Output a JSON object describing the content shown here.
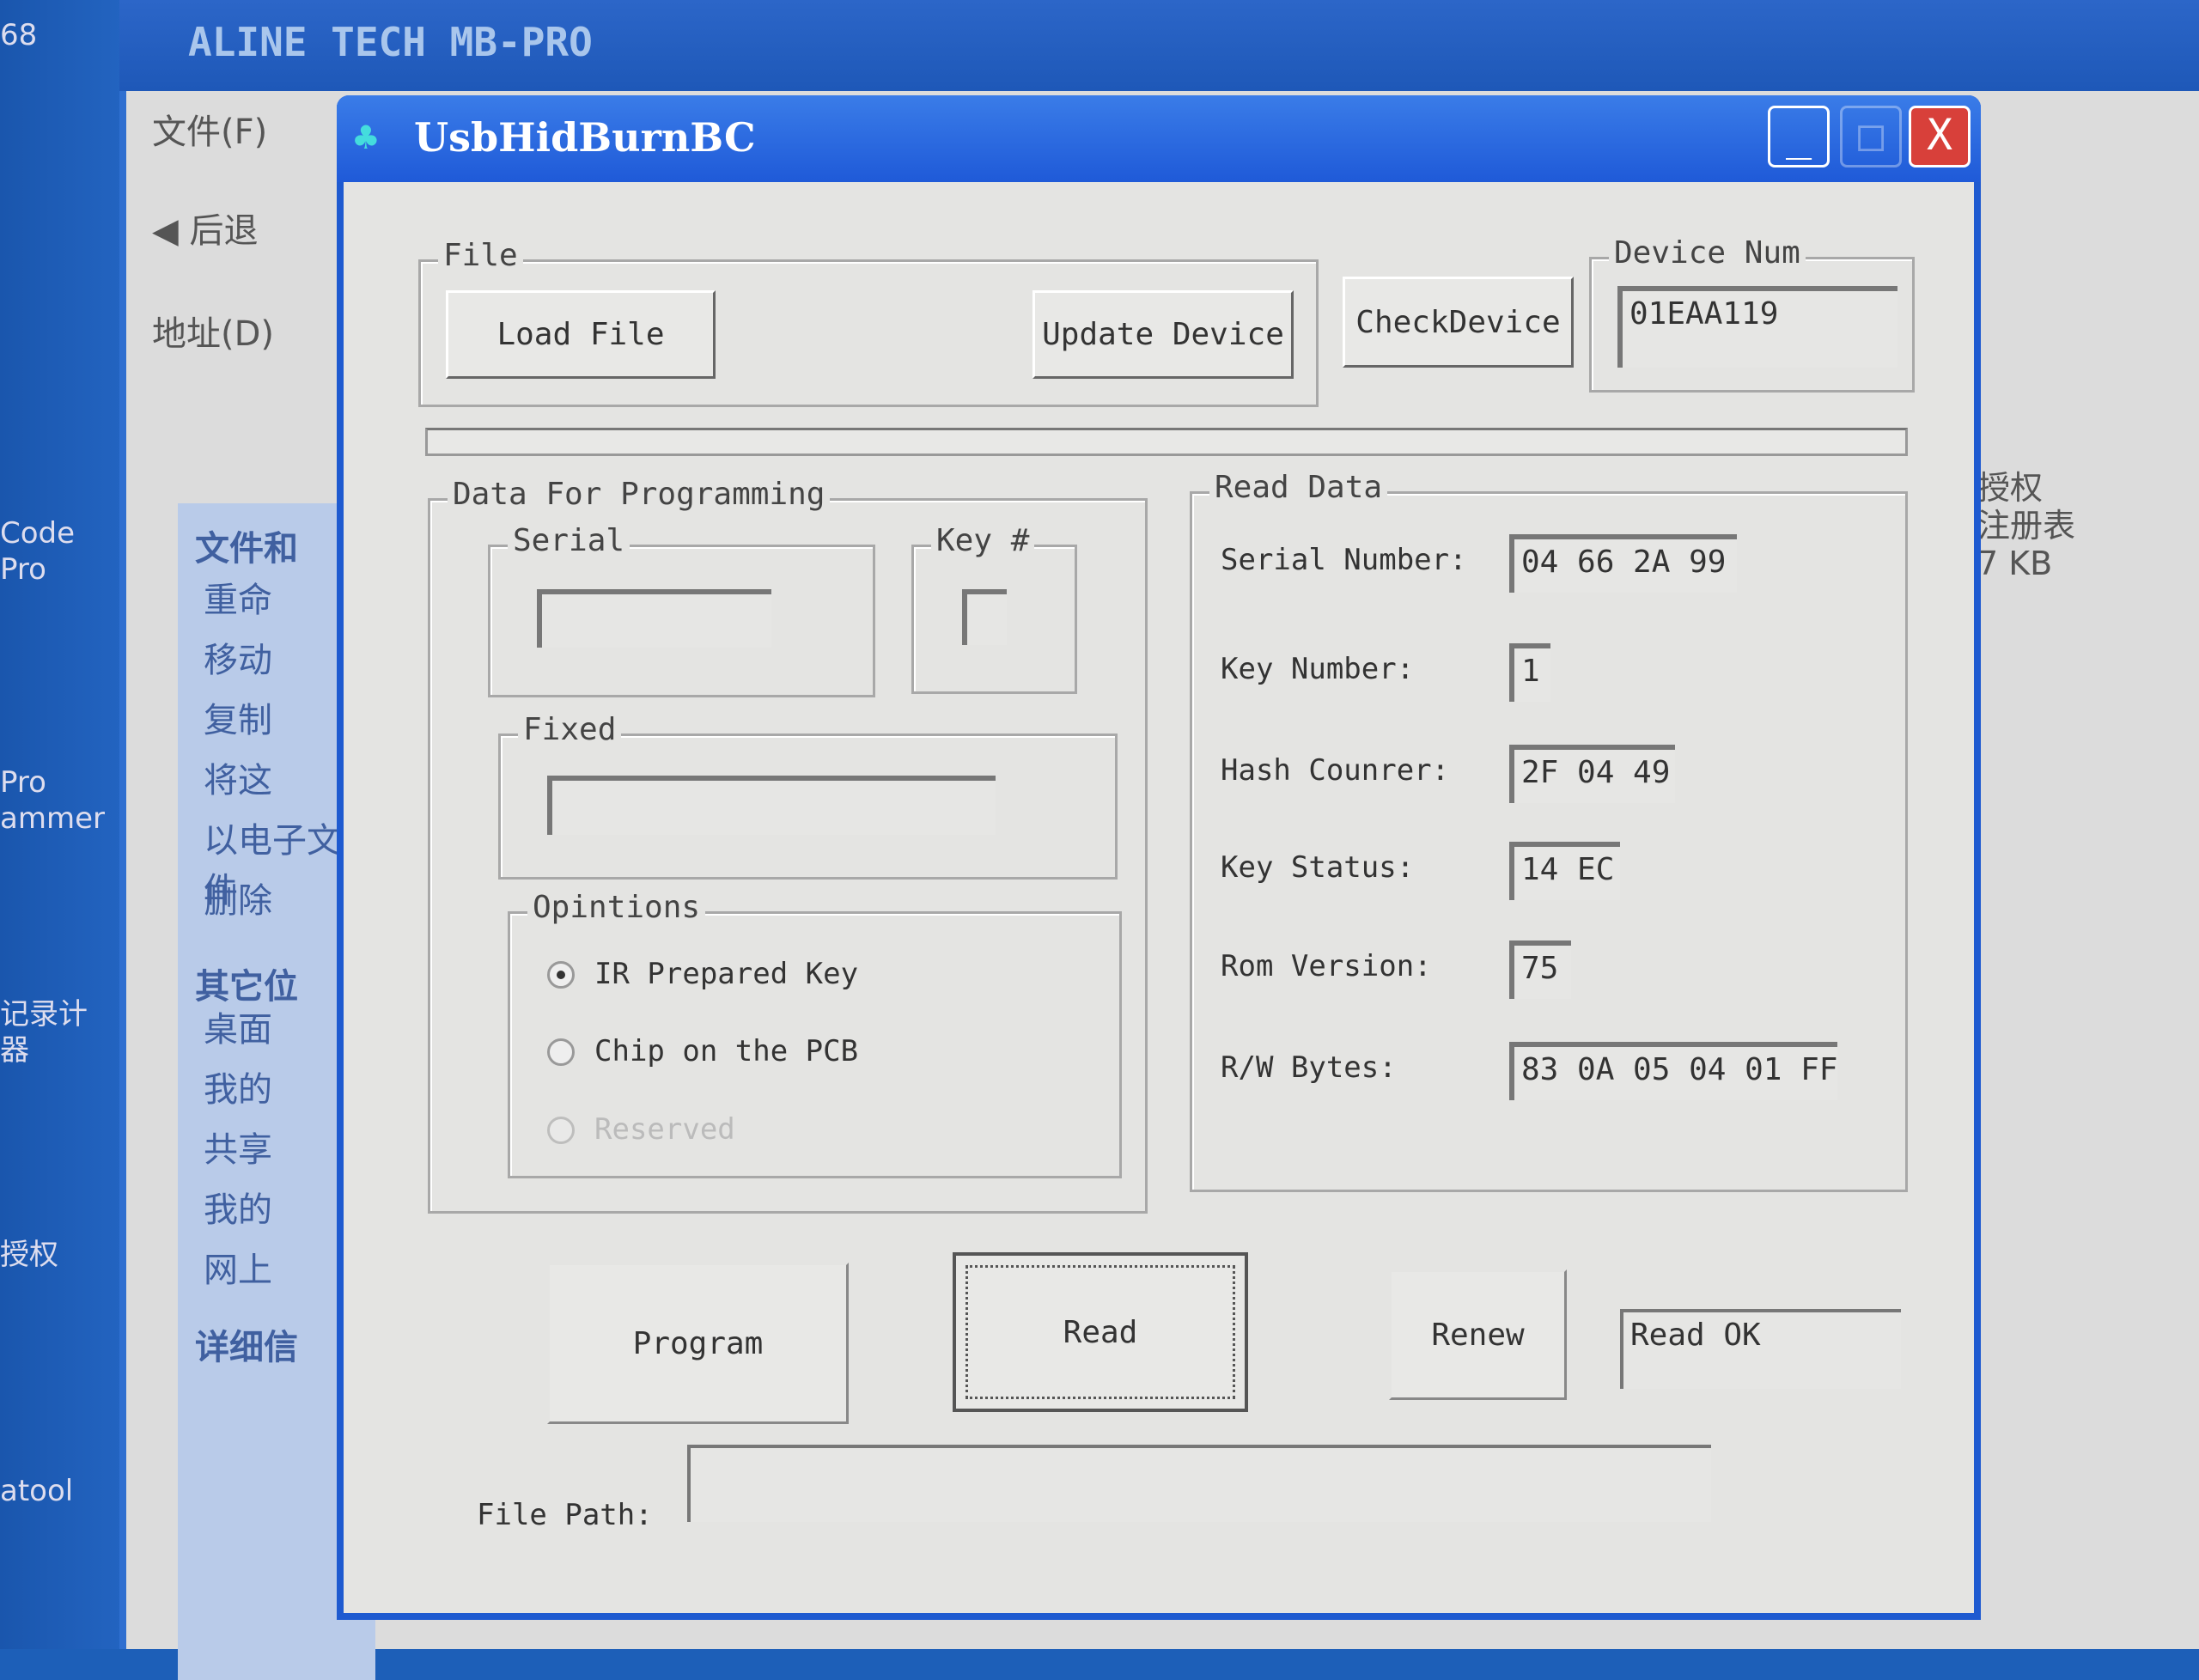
{
  "desktop": {
    "icons": [
      "68",
      "Code\nPro",
      "Pro\nammer",
      "记录计\n器",
      "授权",
      "atool"
    ]
  },
  "explorer": {
    "title": "ALINE TECH MB-PRO",
    "menu_file": "文件(F)",
    "back": "后退",
    "address": "地址(D)",
    "side_header1": "文件和",
    "side_items": [
      "重命",
      "移动",
      "复制",
      "将这",
      "以电子文件",
      "删除"
    ],
    "side_header2": "其它位",
    "other_items": [
      "桌面",
      "我的",
      "共享",
      "我的",
      "网上"
    ],
    "side_header3": "详细信",
    "file_name": "授权",
    "file_type": "注册表",
    "file_size": "7 KB"
  },
  "dialog": {
    "title": "UsbHidBurnBC",
    "minimize": "_",
    "maximize": "□",
    "close": "X",
    "file_group": "File",
    "load_file": "Load File",
    "update_device": "Update Device",
    "check_device": "CheckDevice",
    "device_num_group": "Device Num",
    "device_num": "01EAA119",
    "progress": 0,
    "data_group": "Data For Programming",
    "serial_group": "Serial",
    "serial_value": "",
    "key_group": "Key #",
    "key_value": "",
    "fixed_group": "Fixed",
    "fixed_value": "",
    "options_group": "Opintions",
    "options": [
      {
        "label": "IR Prepared Key",
        "selected": true,
        "enabled": true
      },
      {
        "label": "Chip on the PCB",
        "selected": false,
        "enabled": true
      },
      {
        "label": "Reserved",
        "selected": false,
        "enabled": false
      }
    ],
    "read_group": "Read Data",
    "read_rows": [
      {
        "label": "Serial Number:",
        "value": "04 66 2A 99"
      },
      {
        "label": "Key Number:",
        "value": "1"
      },
      {
        "label": "Hash Counrer:",
        "value": "2F 04 49"
      },
      {
        "label": "Key Status:",
        "value": "14 EC"
      },
      {
        "label": "Rom Version:",
        "value": "75"
      },
      {
        "label": "R/W Bytes:",
        "value": "83 0A 05 04 01 FF"
      }
    ],
    "program": "Program",
    "read": "Read",
    "renew": "Renew",
    "status": "Read OK",
    "file_path_label": "File Path:",
    "file_path": ""
  }
}
